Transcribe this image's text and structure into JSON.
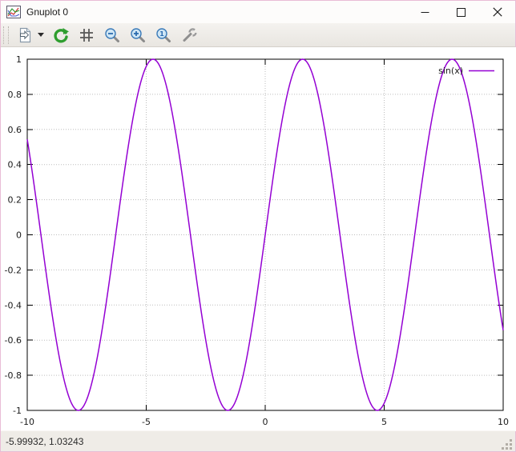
{
  "window": {
    "title": "Gnuplot 0",
    "controls": [
      {
        "name": "minimize"
      },
      {
        "name": "maximize"
      },
      {
        "name": "close"
      }
    ]
  },
  "toolbar": {
    "items": [
      {
        "name": "export-plot",
        "icon": "document-export-icon"
      },
      {
        "name": "export-dropdown",
        "icon": "caret-down-icon"
      },
      {
        "name": "replot",
        "icon": "refresh-arrow-icon",
        "color": "#2f9e2f"
      },
      {
        "name": "toggle-grid",
        "icon": "grid-icon"
      },
      {
        "name": "zoom-out",
        "icon": "magnifier-minus-icon"
      },
      {
        "name": "zoom-in",
        "icon": "magnifier-plus-icon"
      },
      {
        "name": "zoom-reset",
        "icon": "magnifier-one-icon"
      },
      {
        "name": "configure",
        "icon": "wrench-icon"
      }
    ]
  },
  "statusbar": {
    "coordinates": "-5.99932, 1.03243"
  },
  "chart_data": {
    "type": "line",
    "title": "",
    "xlabel": "",
    "ylabel": "",
    "x_range": [
      -10,
      10
    ],
    "y_range": [
      -1,
      1
    ],
    "x_ticks": [
      -10,
      -5,
      0,
      5,
      10
    ],
    "y_ticks": [
      1,
      0.8,
      0.6,
      0.4,
      0.2,
      0,
      -0.2,
      -0.4,
      -0.6,
      -0.8,
      -1
    ],
    "grid": true,
    "legend_position": "top-right",
    "series": [
      {
        "name": "sin(x)",
        "expression": "sin(x)",
        "color": "#9400d3"
      }
    ],
    "colors": {
      "grid": "#bdbdbd",
      "border": "#000000",
      "text": "#1a1a1a"
    }
  }
}
